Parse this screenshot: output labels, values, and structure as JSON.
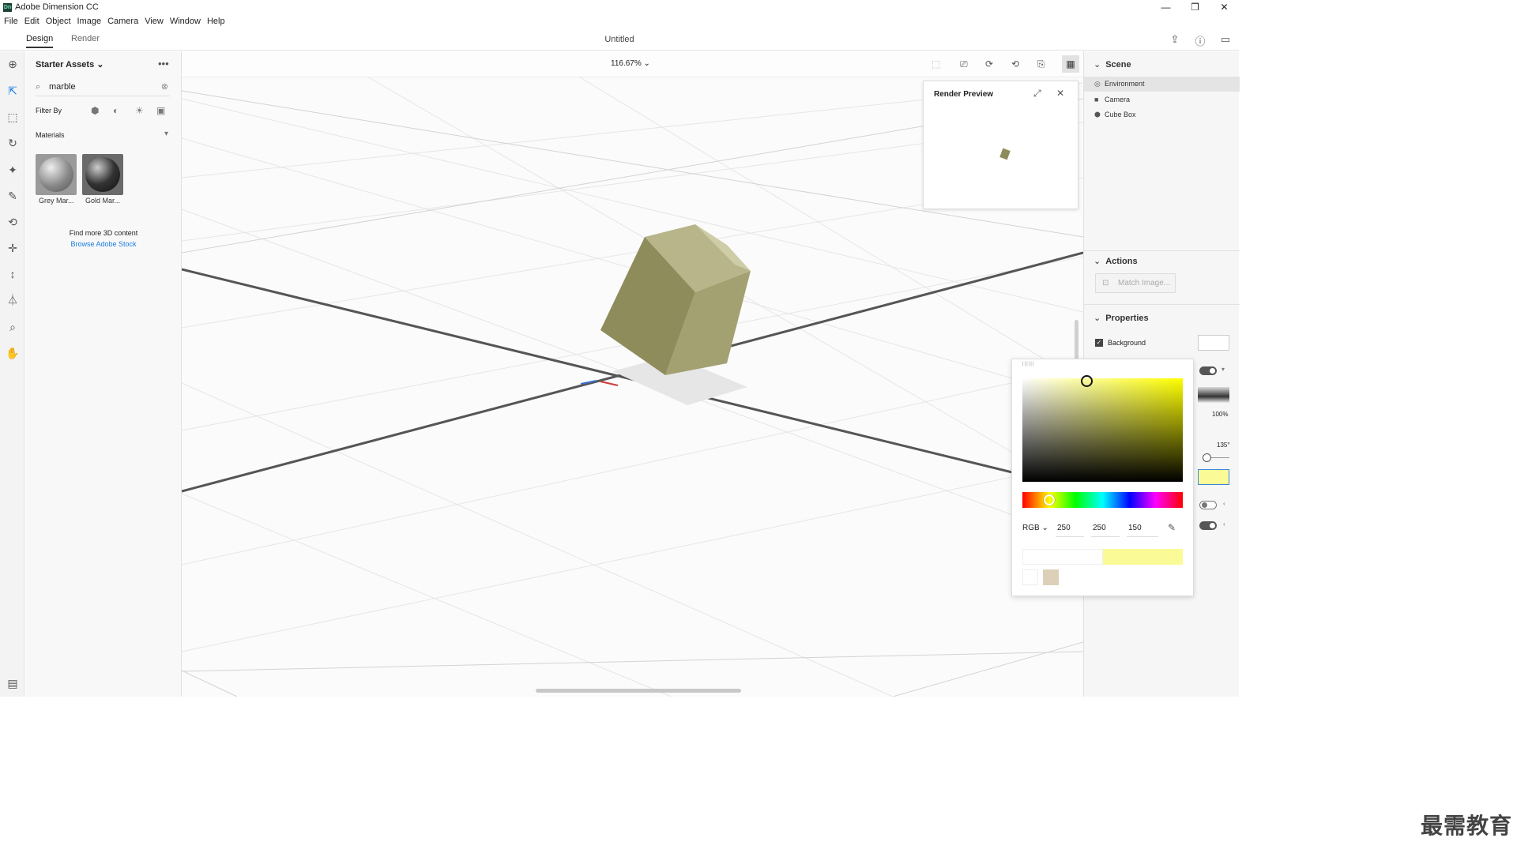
{
  "app": {
    "title": "Adobe Dimension CC",
    "logo_text": "Dn"
  },
  "window_controls": {
    "minimize": "—",
    "restore": "❐",
    "close": "✕"
  },
  "menu": [
    "File",
    "Edit",
    "Object",
    "Image",
    "Camera",
    "View",
    "Window",
    "Help"
  ],
  "tabs": {
    "design": "Design",
    "render": "Render"
  },
  "document": {
    "title": "Untitled"
  },
  "top_icons": [
    "share-icon",
    "help-icon",
    "feedback-icon"
  ],
  "tools": [
    "add-icon",
    "select-icon",
    "magic-select-icon",
    "orbit-icon",
    "magic-wand-icon",
    "sampler-icon",
    "pan-icon",
    "move-icon",
    "dolly-icon",
    "horizon-icon",
    "zoom-icon",
    "hand-icon"
  ],
  "assets": {
    "header": "Starter Assets",
    "search_value": "marble",
    "filter_label": "Filter By",
    "filter_icons": [
      "model-filter-icon",
      "material-filter-icon",
      "light-filter-icon",
      "image-filter-icon"
    ],
    "category": "Materials",
    "items": [
      {
        "label": "Grey Mar...",
        "color": "#6b6b6b"
      },
      {
        "label": "Gold Mar...",
        "color": "#3c3c3c"
      }
    ],
    "find_more": "Find more 3D content",
    "stock_link": "Browse Adobe Stock"
  },
  "viewport": {
    "zoom": "116.67%"
  },
  "render_preview": {
    "title": "Render Preview"
  },
  "scene": {
    "header": "Scene",
    "items": [
      {
        "label": "Environment",
        "icon": "environment-icon"
      },
      {
        "label": "Camera",
        "icon": "camera-icon"
      },
      {
        "label": "Cube Box",
        "icon": "model-icon"
      }
    ]
  },
  "actions": {
    "header": "Actions",
    "match_image": "Match Image..."
  },
  "properties": {
    "header": "Properties",
    "background_label": "Background",
    "background_checked": true,
    "intensity": "100%",
    "rotation": "135°"
  },
  "color_picker": {
    "mode": "RGB",
    "r": "250",
    "g": "250",
    "b": "150",
    "selected_color": "#fafa96",
    "swatches": [
      "#ffffff",
      "#ddd0b8"
    ]
  },
  "watermark": "最需教育"
}
